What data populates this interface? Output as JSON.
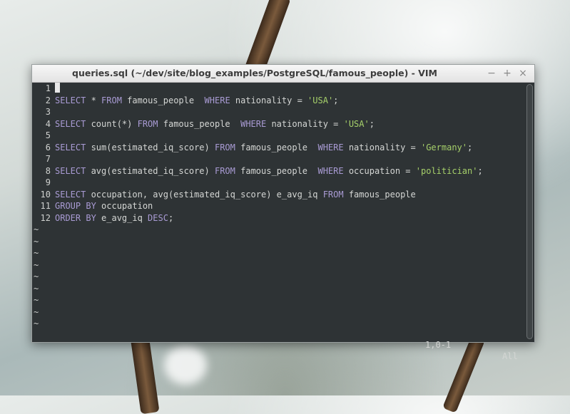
{
  "window": {
    "title": "queries.sql (~/dev/site/blog_examples/PostgreSQL/famous_people) - VIM",
    "controls": {
      "minimize": "−",
      "maximize": "+",
      "close": "×"
    }
  },
  "editor": {
    "lines": [
      {
        "num": "1",
        "segments": []
      },
      {
        "num": "2",
        "segments": [
          {
            "t": "kw",
            "v": "SELECT"
          },
          {
            "t": "p",
            "v": " * "
          },
          {
            "t": "kw",
            "v": "FROM"
          },
          {
            "t": "p",
            "v": " famous_people  "
          },
          {
            "t": "kw",
            "v": "WHERE"
          },
          {
            "t": "p",
            "v": " nationality = "
          },
          {
            "t": "str",
            "v": "'USA'"
          },
          {
            "t": "p",
            "v": ";"
          }
        ]
      },
      {
        "num": "3",
        "segments": []
      },
      {
        "num": "4",
        "segments": [
          {
            "t": "kw",
            "v": "SELECT"
          },
          {
            "t": "p",
            "v": " count(*) "
          },
          {
            "t": "kw",
            "v": "FROM"
          },
          {
            "t": "p",
            "v": " famous_people  "
          },
          {
            "t": "kw",
            "v": "WHERE"
          },
          {
            "t": "p",
            "v": " nationality = "
          },
          {
            "t": "str",
            "v": "'USA'"
          },
          {
            "t": "p",
            "v": ";"
          }
        ]
      },
      {
        "num": "5",
        "segments": []
      },
      {
        "num": "6",
        "segments": [
          {
            "t": "kw",
            "v": "SELECT"
          },
          {
            "t": "p",
            "v": " sum(estimated_iq_score) "
          },
          {
            "t": "kw",
            "v": "FROM"
          },
          {
            "t": "p",
            "v": " famous_people  "
          },
          {
            "t": "kw",
            "v": "WHERE"
          },
          {
            "t": "p",
            "v": " nationality = "
          },
          {
            "t": "str",
            "v": "'Germany'"
          },
          {
            "t": "p",
            "v": ";"
          }
        ]
      },
      {
        "num": "7",
        "segments": []
      },
      {
        "num": "8",
        "segments": [
          {
            "t": "kw",
            "v": "SELECT"
          },
          {
            "t": "p",
            "v": " avg(estimated_iq_score) "
          },
          {
            "t": "kw",
            "v": "FROM"
          },
          {
            "t": "p",
            "v": " famous_people  "
          },
          {
            "t": "kw",
            "v": "WHERE"
          },
          {
            "t": "p",
            "v": " occupation = "
          },
          {
            "t": "str",
            "v": "'politician'"
          },
          {
            "t": "p",
            "v": ";"
          }
        ]
      },
      {
        "num": "9",
        "segments": []
      },
      {
        "num": "10",
        "segments": [
          {
            "t": "kw",
            "v": "SELECT"
          },
          {
            "t": "p",
            "v": " occupation, avg(estimated_iq_score) e_avg_iq "
          },
          {
            "t": "kw",
            "v": "FROM"
          },
          {
            "t": "p",
            "v": " famous_people"
          }
        ]
      },
      {
        "num": "11",
        "segments": [
          {
            "t": "kw",
            "v": "GROUP BY"
          },
          {
            "t": "p",
            "v": " occupation"
          }
        ]
      },
      {
        "num": "12",
        "segments": [
          {
            "t": "kw",
            "v": "ORDER BY"
          },
          {
            "t": "p",
            "v": " e_avg_iq "
          },
          {
            "t": "kw",
            "v": "DESC"
          },
          {
            "t": "p",
            "v": ";"
          }
        ]
      }
    ],
    "empty_line_marker": "~",
    "empty_line_count": 9
  },
  "status": {
    "ruler": "1,0-1",
    "position": "All"
  },
  "colors": {
    "keyword": "#a99bd4",
    "string": "#a6d06a",
    "background": "#2e3335"
  }
}
